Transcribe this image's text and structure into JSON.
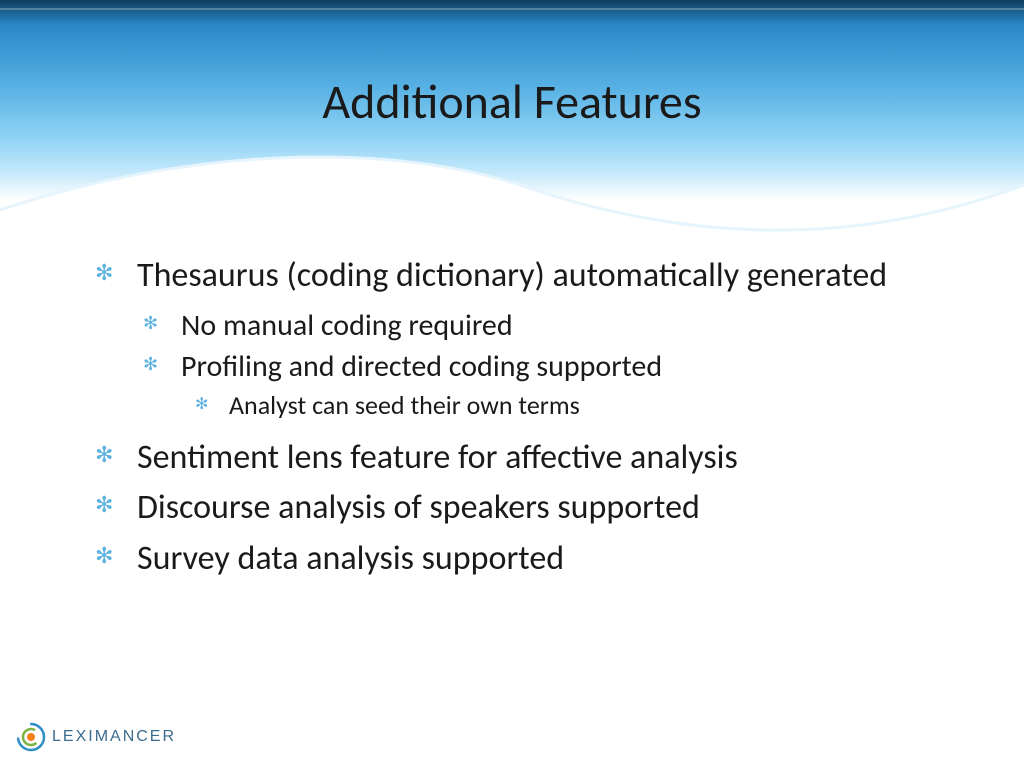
{
  "title": "Additional Features",
  "bullets": {
    "item1": {
      "text": "Thesaurus (coding dictionary) automatically generated",
      "sub1": "No manual coding required",
      "sub2": {
        "text": "Profiling and directed coding supported",
        "subA": "Analyst can seed their own terms"
      }
    },
    "item2": "Sentiment lens feature for affective analysis",
    "item3": "Discourse analysis of speakers supported",
    "item4": "Survey data analysis supported"
  },
  "logo": {
    "text": "LEXIMANCER"
  }
}
